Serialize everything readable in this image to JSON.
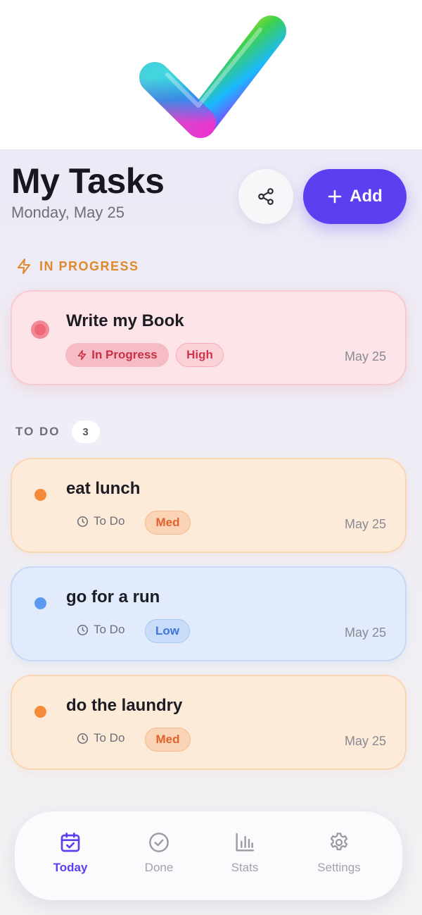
{
  "header": {
    "title": "My Tasks",
    "date": "Monday, May 25",
    "add_label": "Add"
  },
  "icons": {
    "logo": "rainbow-checkmark-logo",
    "share": "share-icon",
    "add": "plus-icon",
    "in_progress": "lightning-icon",
    "status_todo": "clock-icon"
  },
  "sections": {
    "in_progress_label": "IN PROGRESS",
    "todo_label": "TO DO",
    "todo_count": "3"
  },
  "in_progress_tasks": [
    {
      "title": "Write my Book",
      "status": "In Progress",
      "priority": "High",
      "date": "May 25",
      "color": "#ee6877"
    }
  ],
  "todo_tasks": [
    {
      "title": "eat lunch",
      "status": "To Do",
      "priority": "Med",
      "date": "May 25",
      "color": "#f48b3a"
    },
    {
      "title": "go for a run",
      "status": "To Do",
      "priority": "Low",
      "date": "May 25",
      "color": "#5b9af0"
    },
    {
      "title": "do the laundry",
      "status": "To Do",
      "priority": "Med",
      "date": "May 25",
      "color": "#f48b3a"
    }
  ],
  "nav": {
    "items": [
      {
        "label": "Today",
        "icon": "calendar-check-icon",
        "active": true
      },
      {
        "label": "Done",
        "icon": "check-circle-icon",
        "active": false
      },
      {
        "label": "Stats",
        "icon": "bar-chart-icon",
        "active": false
      },
      {
        "label": "Settings",
        "icon": "gear-icon",
        "active": false
      }
    ]
  },
  "colors": {
    "accent": "#5b3ff0",
    "in_progress_section": "#e0892a",
    "high": "#d0364b",
    "med": "#e0622a",
    "low": "#3b77d8"
  }
}
